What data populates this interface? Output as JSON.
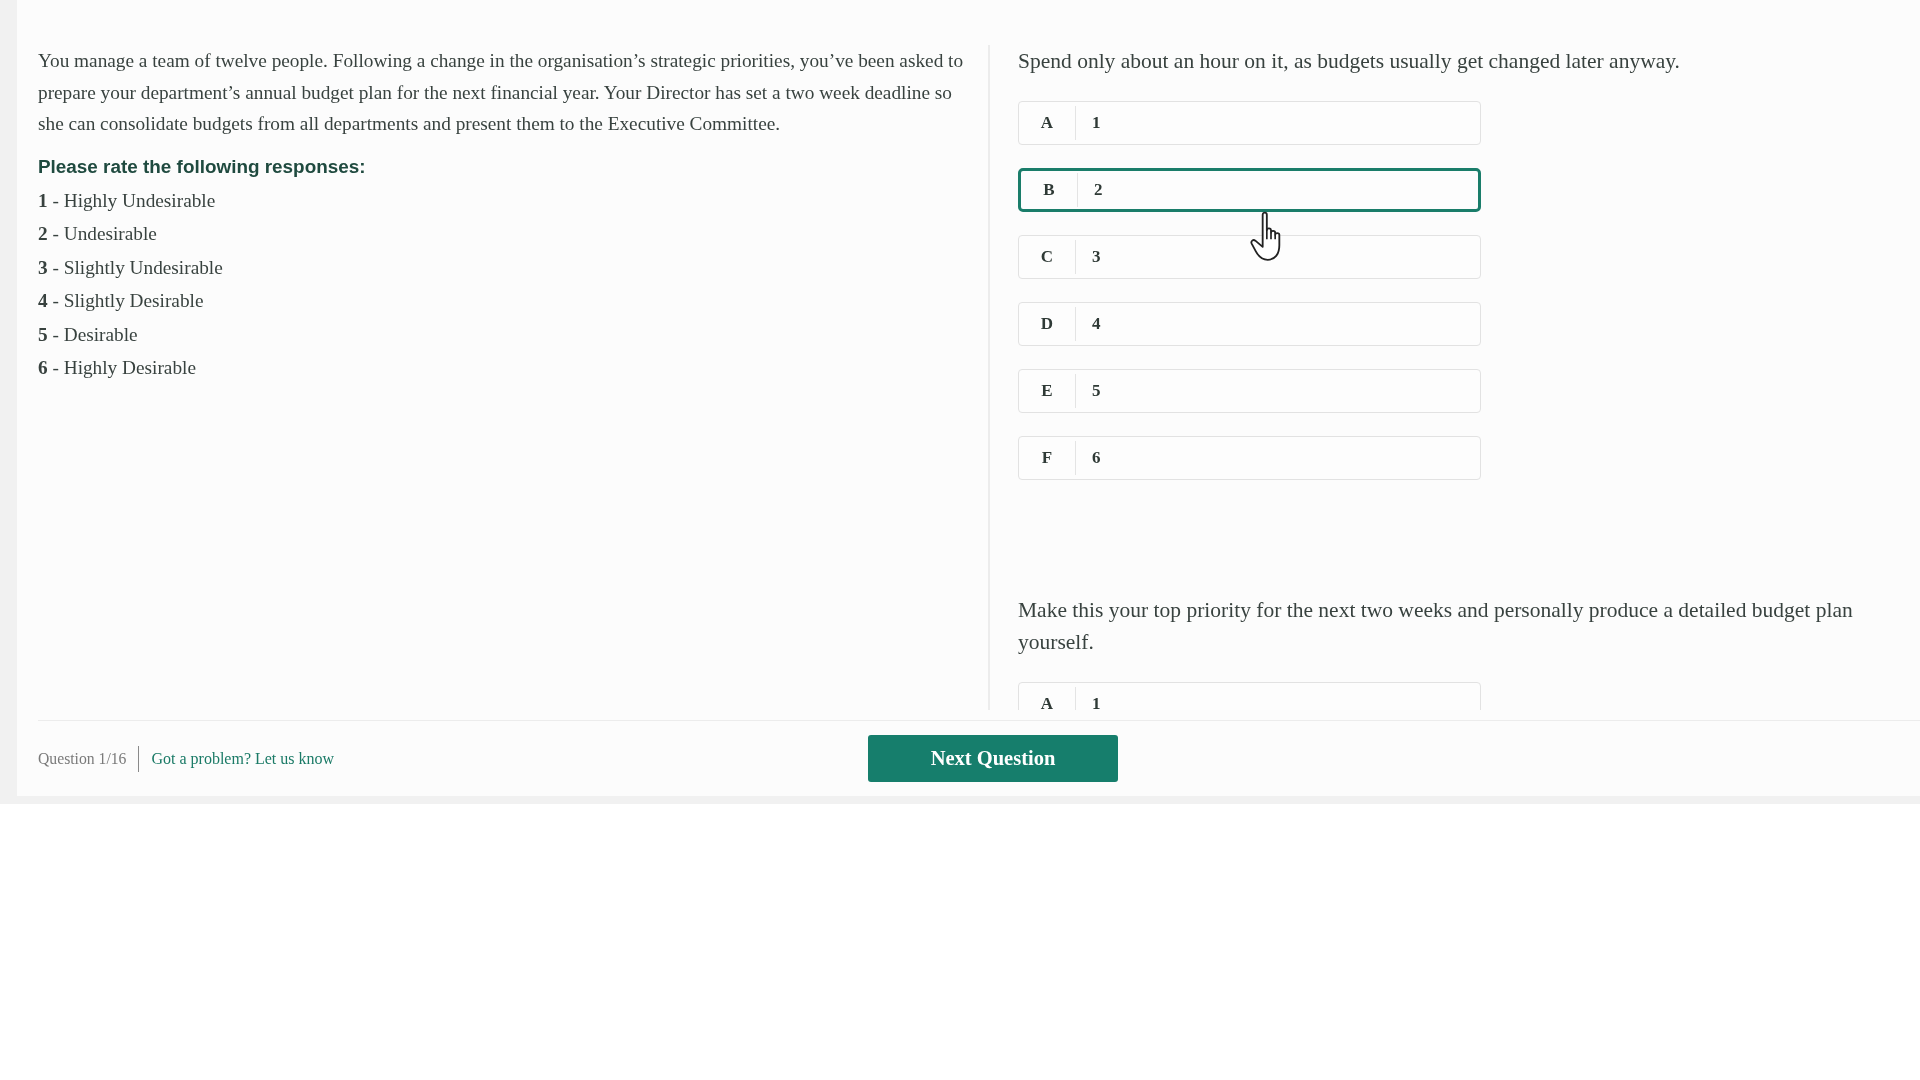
{
  "scenario": "You manage a team of twelve people. Following a change in the organisation’s strategic priorities, you’ve been asked to prepare your department’s annual budget plan for the next financial year. Your Director has set a two week deadline so she can consolidate budgets from all departments and present them to the Executive Committee.",
  "rating_scale": {
    "heading": "Please rate the following responses:",
    "items": [
      "**1** - Highly Undesirable",
      "**2** - Undesirable",
      "**3** - Slightly Undesirable",
      "**4** - Slightly Desirable",
      "**5** - Desirable",
      "**6** - Highly Desirable"
    ]
  },
  "responses": [
    {
      "text": "Spend only about an hour on it, as budgets usually get changed later anyway.",
      "options": [
        {
          "letter": "A",
          "value": "1",
          "selected": false
        },
        {
          "letter": "B",
          "value": "2",
          "selected": true
        },
        {
          "letter": "C",
          "value": "3",
          "selected": false
        },
        {
          "letter": "D",
          "value": "4",
          "selected": false
        },
        {
          "letter": "E",
          "value": "5",
          "selected": false
        },
        {
          "letter": "F",
          "value": "6",
          "selected": false
        }
      ]
    },
    {
      "text": "Make this your top priority for the next two weeks and personally produce a detailed budget plan yourself.",
      "options": [
        {
          "letter": "A",
          "value": "1",
          "selected": false
        }
      ]
    }
  ],
  "footer": {
    "question_number": "Question 1/16",
    "problem_link": "Got a problem? Let us know",
    "next_button": "Next Question"
  }
}
